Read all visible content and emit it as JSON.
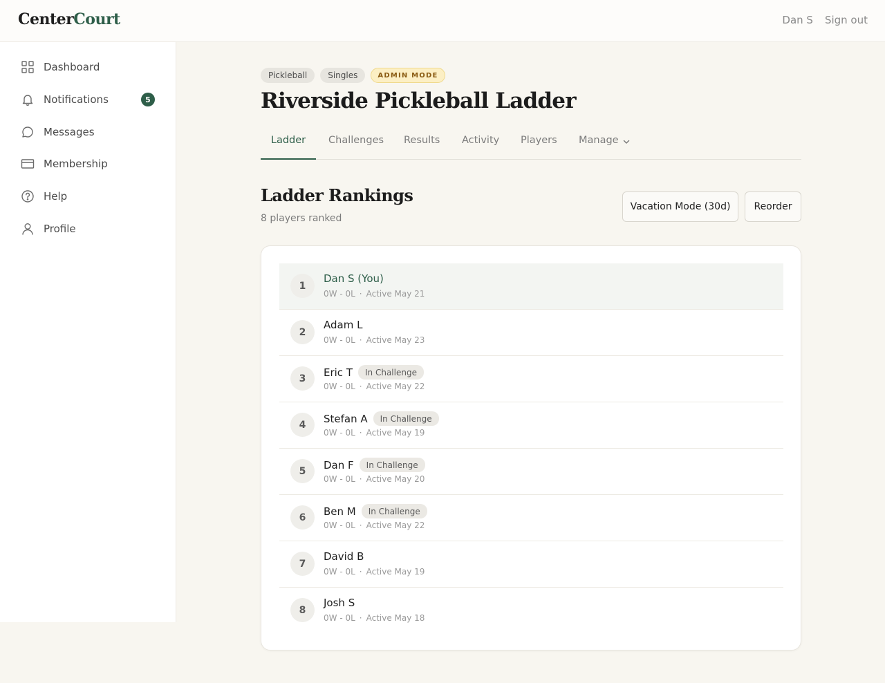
{
  "app": {
    "logo_part1": "Center",
    "logo_part2": "Court"
  },
  "header": {
    "user": "Dan S",
    "signout": "Sign out"
  },
  "sidebar": {
    "items": [
      {
        "label": "Dashboard",
        "icon": "grid-icon"
      },
      {
        "label": "Notifications",
        "icon": "bell-icon",
        "badge": "5"
      },
      {
        "label": "Messages",
        "icon": "chat-bubble-icon"
      },
      {
        "label": "Membership",
        "icon": "credit-card-icon"
      },
      {
        "label": "Help",
        "icon": "question-circle-icon"
      },
      {
        "label": "Profile",
        "icon": "user-icon"
      }
    ]
  },
  "ladder": {
    "chips": [
      "Pickleball",
      "Singles",
      "ADMIN MODE"
    ],
    "title": "Riverside Pickleball Ladder",
    "tabs": [
      "Ladder",
      "Challenges",
      "Results",
      "Activity",
      "Players",
      "Manage"
    ],
    "active_tab": "Ladder"
  },
  "rankings": {
    "title": "Ladder Rankings",
    "subtitle": "8 players ranked",
    "vacation_button": "Vacation Mode (30d)",
    "reorder_button": "Reorder",
    "players": [
      {
        "rank": "1",
        "name": "Dan S (You)",
        "record": "0W - 0L",
        "active": "Active May 21",
        "tag": "",
        "you": true
      },
      {
        "rank": "2",
        "name": "Adam L",
        "record": "0W - 0L",
        "active": "Active May 23",
        "tag": ""
      },
      {
        "rank": "3",
        "name": "Eric T",
        "record": "0W - 0L",
        "active": "Active May 22",
        "tag": "In Challenge"
      },
      {
        "rank": "4",
        "name": "Stefan A",
        "record": "0W - 0L",
        "active": "Active May 19",
        "tag": "In Challenge"
      },
      {
        "rank": "5",
        "name": "Dan F",
        "record": "0W - 0L",
        "active": "Active May 20",
        "tag": "In Challenge"
      },
      {
        "rank": "6",
        "name": "Ben M",
        "record": "0W - 0L",
        "active": "Active May 22",
        "tag": "In Challenge"
      },
      {
        "rank": "7",
        "name": "David B",
        "record": "0W - 0L",
        "active": "Active May 19",
        "tag": ""
      },
      {
        "rank": "8",
        "name": "Josh S",
        "record": "0W - 0L",
        "active": "Active May 18",
        "tag": ""
      }
    ]
  },
  "colors": {
    "accent": "#2e5e49",
    "background": "#f8f6f0",
    "admin_chip": "#fcefc4"
  }
}
